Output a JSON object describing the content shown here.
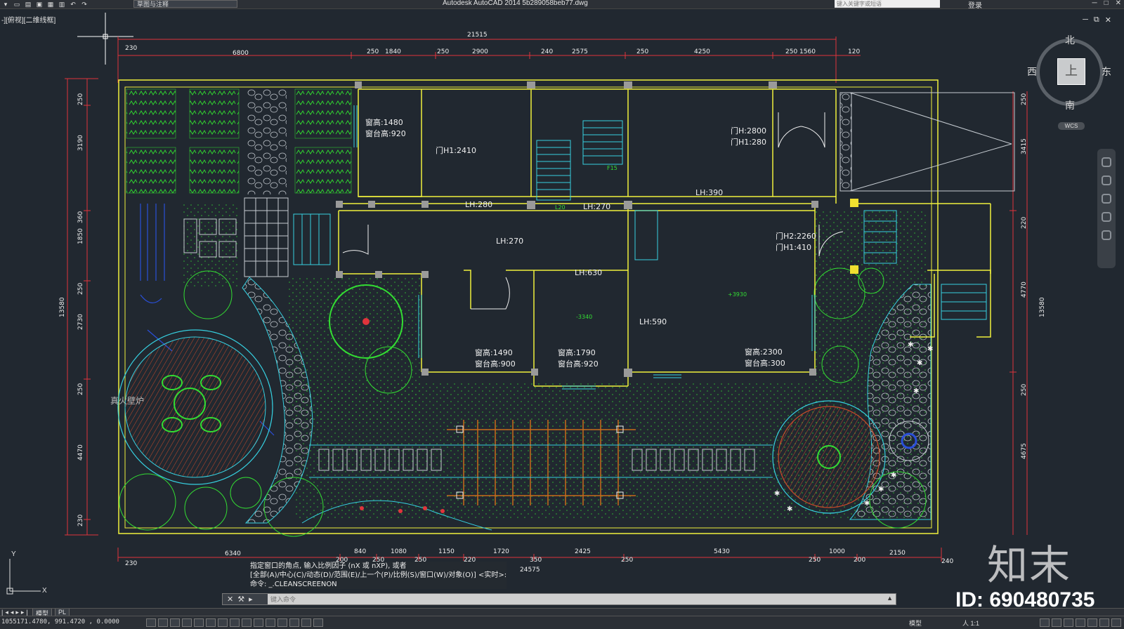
{
  "app": {
    "title": "Autodesk AutoCAD 2014    5b289058beb77.dwg",
    "workspace": "草图与注释",
    "search_placeholder": "键入关键字或短语",
    "signin_label": "登录",
    "window_controls": [
      "─",
      "□",
      "✕"
    ]
  },
  "viewport": {
    "label": "-][俯视][二维线框]",
    "controls": [
      "─",
      "⧉",
      "✕"
    ]
  },
  "viewcube": {
    "north": "北",
    "south": "南",
    "east": "东",
    "west": "西",
    "face": "上",
    "wcs": "WCS"
  },
  "drawing": {
    "overall_width": "21515",
    "top_dims": [
      "230",
      "6800",
      "250",
      "1840",
      "250",
      "2900",
      "240",
      "2575",
      "250",
      "4250",
      "250 1560",
      "120"
    ],
    "bottom_dims": [
      "230",
      "6340",
      "200",
      "840",
      "250",
      "1080",
      "250",
      "1150",
      "220",
      "1720",
      "350",
      "2425",
      "250",
      "5430",
      "250",
      "1000",
      "200",
      "2150",
      "240",
      "24575"
    ],
    "left_dims": [
      "250",
      "3190",
      "360",
      "1850",
      "250",
      "2730",
      "250",
      "4470",
      "230",
      "13580"
    ],
    "right_dims": [
      "250",
      "3415",
      "220",
      "4770",
      "250",
      "4675",
      "13580"
    ],
    "labels": {
      "win1_h": "窗高:1480",
      "win1_sill": "窗台高:920",
      "door1": "门H1:2410",
      "door2_h": "门H:2800",
      "door2_h1": "门H1:280",
      "lh390": "LH:390",
      "lh280": "LH:280",
      "lh270a": "LH:270",
      "lh270b": "LH:270",
      "lh630": "LH:630",
      "lh590": "LH:590",
      "door3_h2": "门H2:2260",
      "door3_h1": "门H1:410",
      "win2_h": "窗高:1490",
      "win2_sill": "窗台高:900",
      "win3_h": "窗高:1790",
      "win3_sill": "窗台高:920",
      "win4_h": "窗高:2300",
      "win4_sill": "窗台高:300",
      "fireplace": "真火壁炉",
      "stair1": "F15",
      "stair2": "L20",
      "level1": "-3340",
      "level2": "+3930"
    }
  },
  "command": {
    "history": [
      "指定窗口的角点, 输入比例因子 (nX 或 nXP), 或者",
      "[全部(A)/中心(C)/动态(D)/范围(E)/上一个(P)/比例(S)/窗口(W)/对象(O)] <实时>:",
      "命令: _.CLEANSCREENON"
    ],
    "placeholder": "键入命令"
  },
  "tabs": {
    "model": "模型",
    "layout": "PL"
  },
  "status": {
    "coords": "1055171.4780, 991.4720 , 0.0000",
    "model": "模型",
    "scale": "人 1:1"
  },
  "watermark": {
    "logo": "知末",
    "id": "ID: 690480735"
  },
  "colors": {
    "background": "#212830",
    "wall": "#f0f03c",
    "dimension": "#e0343c",
    "text": "#f0f0f0",
    "cyan": "#36d0e0",
    "vegetation": "#33dd33",
    "paving": "#c84a2a"
  }
}
